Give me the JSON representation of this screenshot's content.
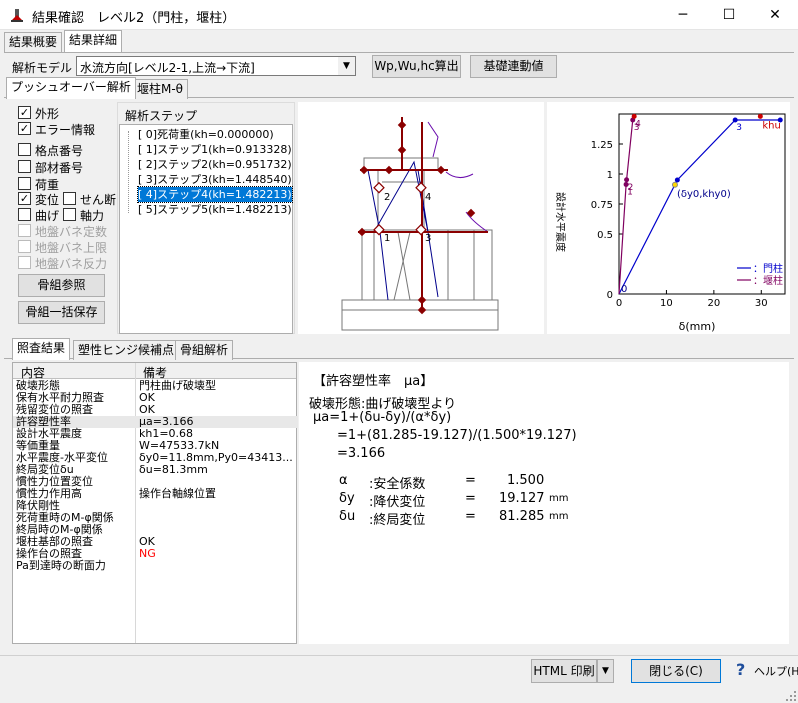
{
  "window": {
    "title": "結果確認　レベル2（門柱，堰柱）",
    "minimize": "─",
    "maximize": "☐",
    "close": "✕"
  },
  "top_tabs": [
    {
      "label": "結果概要"
    },
    {
      "label": "結果詳細"
    }
  ],
  "model": {
    "label": "解析モデル",
    "selected": "水流方向[レベル2-1,上流→下流]"
  },
  "buttons": {
    "wp": "Wp,Wu,hc算出",
    "kiso": "基礎連動値",
    "skeleton_ref": "骨組参照",
    "skeleton_save": "骨組一括保存",
    "html_print": "HTML 印刷",
    "close": "閉じる(C)",
    "help": "ヘルプ(H)"
  },
  "sub_tabs": [
    {
      "label": "プッシュオーバー解析"
    },
    {
      "label": "堰柱M‐θ"
    }
  ],
  "checkboxes": [
    {
      "label": "外形",
      "checked": true,
      "enabled": true
    },
    {
      "label": "エラー情報",
      "checked": true,
      "enabled": true
    },
    {
      "label": "格点番号",
      "checked": false,
      "enabled": true
    },
    {
      "label": "部材番号",
      "checked": false,
      "enabled": true
    },
    {
      "label": "荷重",
      "checked": false,
      "enabled": true
    },
    {
      "label": "変位",
      "checked": true,
      "enabled": true
    },
    {
      "label": "せん断",
      "checked": false,
      "enabled": true
    },
    {
      "label": "曲げ",
      "checked": false,
      "enabled": true
    },
    {
      "label": "軸力",
      "checked": false,
      "enabled": true
    },
    {
      "label": "地盤バネ定数",
      "checked": false,
      "enabled": false
    },
    {
      "label": "地盤バネ上限",
      "checked": false,
      "enabled": false
    },
    {
      "label": "地盤バネ反力",
      "checked": false,
      "enabled": false
    }
  ],
  "steps": {
    "title": "解析ステップ",
    "items": [
      {
        "label": "[ 0]死荷重(kh=0.000000)",
        "selected": false
      },
      {
        "label": "[ 1]ステップ1(kh=0.913328)",
        "selected": false
      },
      {
        "label": "[ 2]ステップ2(kh=0.951732)",
        "selected": false
      },
      {
        "label": "[ 3]ステップ3(kh=1.448540)",
        "selected": false
      },
      {
        "label": "[ 4]ステップ4(kh=1.482213)",
        "selected": true
      },
      {
        "label": "[ 5]ステップ5(kh=1.482213)",
        "selected": false
      }
    ]
  },
  "frame_labels": [
    "2",
    "4",
    "1",
    "3"
  ],
  "chart_data": {
    "type": "line",
    "xlabel": "δ(mm)",
    "ylabel": "設計水平震度",
    "xlim": [
      0,
      35
    ],
    "ylim": [
      0,
      1.5
    ],
    "xticks": [
      "0",
      "10",
      "20",
      "30"
    ],
    "yticks": [
      "0",
      "0.5",
      "0.75",
      "1",
      "1.25"
    ],
    "series": [
      {
        "name": "：門柱",
        "color": "#0000cc",
        "x": [
          0,
          12.3,
          24.5,
          34
        ],
        "y": [
          0,
          0.95,
          1.45,
          1.45
        ],
        "point_labels": [
          "0",
          "",
          "3",
          ""
        ]
      },
      {
        "name": "：堰柱",
        "color": "#800060",
        "x": [
          0,
          1.5,
          1.6,
          2.9,
          3.2
        ],
        "y": [
          0,
          0.913,
          0.952,
          1.45,
          1.48
        ],
        "point_labels": [
          "",
          "1",
          "2",
          "3",
          "4"
        ]
      }
    ],
    "annotations": [
      "khu",
      "(δy0,khy0)"
    ],
    "legend": "bottom-right"
  },
  "result_tabs": [
    {
      "label": "照査結果"
    },
    {
      "label": "塑性ヒンジ候補点"
    },
    {
      "label": "骨組解析"
    }
  ],
  "table": {
    "headers": [
      "内容",
      "備考"
    ],
    "rows": [
      [
        "破壊形態",
        "門柱曲げ破壊型"
      ],
      [
        "保有水平耐力照査",
        "OK"
      ],
      [
        "残留変位の照査",
        "OK"
      ],
      [
        "許容塑性率",
        "μa=3.166"
      ],
      [
        "設計水平震度",
        "kh1=0.68"
      ],
      [
        "等価重量",
        "W=47533.7kN"
      ],
      [
        "水平震度-水平変位",
        "δy0=11.8mm,Py0=43413..."
      ],
      [
        "終局変位δu",
        "δu=81.3mm"
      ],
      [
        "慣性力位置変位",
        ""
      ],
      [
        "慣性力作用高",
        "操作台軸線位置"
      ],
      [
        "降伏剛性",
        ""
      ],
      [
        "死荷重時のM-φ関係",
        ""
      ],
      [
        "終局時のM-φ関係",
        ""
      ],
      [
        "堰柱基部の照査",
        "OK"
      ],
      [
        "操作台の照査",
        "NG"
      ],
      [
        "Pa到達時の断面力",
        ""
      ]
    ]
  },
  "detail": {
    "title": "【許容塑性率　μa】",
    "lines": [
      "破壊形態:曲げ破壊型より",
      "μa=1+(δu-δy)/(α*δy)",
      "=1+(81.285-19.127)/(1.500*19.127)",
      "=3.166"
    ],
    "params": [
      {
        "sym": "α",
        "desc": ":安全係数",
        "eq": "=",
        "val": "1.500",
        "unit": ""
      },
      {
        "sym": "δy",
        "desc": ":降伏変位",
        "eq": "=",
        "val": "19.127",
        "unit": "mm"
      },
      {
        "sym": "δu",
        "desc": ":終局変位",
        "eq": "=",
        "val": "81.285",
        "unit": "mm"
      }
    ]
  },
  "colors": {
    "ng": "#ff0000",
    "selection": "#0078d7",
    "frame": "#8b0000"
  }
}
